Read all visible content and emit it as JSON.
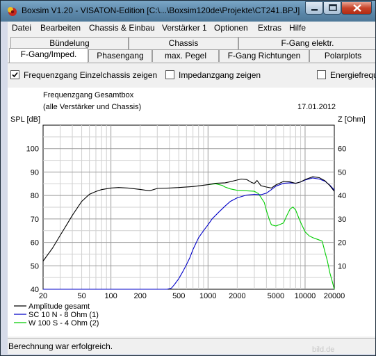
{
  "window": {
    "title": "Boxsim V1.20 - VISATON-Edition [C:\\...\\Boxsim120de\\Projekte\\CT241.BPJ]"
  },
  "menu": [
    "Datei",
    "Bearbeiten",
    "Chassis & Einbau",
    "Verstärker 1",
    "Optionen",
    "Extras",
    "Hilfe"
  ],
  "tabs_back": [
    "Bündelung",
    "Chassis",
    "F-Gang elektr."
  ],
  "tabs_front": [
    "F-Gang/Imped.",
    "Phasengang",
    "max. Pegel",
    "F-Gang Richtungen",
    "Polarplots"
  ],
  "checkboxes": [
    {
      "label": "Frequenzgang Einzelchassis zeigen",
      "checked": true
    },
    {
      "label": "Impedanzgang zeigen",
      "checked": false
    },
    {
      "label": "Energiefrequ",
      "checked": false
    }
  ],
  "status": "Berechnung war erfolgreich.",
  "watermark": "bild.de",
  "chart_data": {
    "type": "line",
    "title": "Frequenzgang Gesamtbox",
    "subtitle": "(alle Verstärker und Chassis)",
    "date": "17.01.2012",
    "ylabel": "SPL [dB]",
    "y2label": "Z [Ohm]",
    "xscale": "log",
    "xlim": [
      20,
      20000
    ],
    "ylim": [
      40,
      110
    ],
    "y2lim": [
      0,
      70
    ],
    "xticks": [
      "20",
      "50",
      "100",
      "200",
      "500",
      "1000",
      "2000",
      "5000",
      "10000",
      "20000"
    ],
    "yticks": [
      "40",
      "50",
      "60",
      "70",
      "80",
      "90",
      "100"
    ],
    "y2ticks": [
      "10",
      "20",
      "30",
      "40",
      "50",
      "60"
    ],
    "grid": true,
    "legend": "bottom-left",
    "series": [
      {
        "name": "Amplitude gesamt",
        "color": "#000000",
        "points": [
          [
            20,
            52
          ],
          [
            25,
            57.5
          ],
          [
            30,
            63
          ],
          [
            35,
            67.5
          ],
          [
            40,
            71.5
          ],
          [
            50,
            77.5
          ],
          [
            60,
            80.5
          ],
          [
            70,
            81.7
          ],
          [
            80,
            82.5
          ],
          [
            100,
            83.2
          ],
          [
            120,
            83.4
          ],
          [
            150,
            83.2
          ],
          [
            200,
            82.6
          ],
          [
            250,
            82
          ],
          [
            300,
            83
          ],
          [
            400,
            83.2
          ],
          [
            500,
            83.4
          ],
          [
            700,
            83.8
          ],
          [
            1000,
            84.6
          ],
          [
            1200,
            85.2
          ],
          [
            1500,
            85.4
          ],
          [
            1700,
            85.9
          ],
          [
            2000,
            86.6
          ],
          [
            2200,
            87
          ],
          [
            2500,
            86.8
          ],
          [
            2800,
            85.6
          ],
          [
            3000,
            85.1
          ],
          [
            3200,
            86.4
          ],
          [
            3500,
            84.2
          ],
          [
            4000,
            83.6
          ],
          [
            4500,
            83.2
          ],
          [
            5000,
            84.5
          ],
          [
            6000,
            86
          ],
          [
            7000,
            85.8
          ],
          [
            8000,
            85.2
          ],
          [
            9000,
            85.8
          ],
          [
            10000,
            86.8
          ],
          [
            12000,
            88
          ],
          [
            14000,
            87.6
          ],
          [
            16000,
            86.3
          ],
          [
            18000,
            84.2
          ],
          [
            20000,
            81.8
          ]
        ]
      },
      {
        "name": "SC 10 N - 8 Ohm (1)",
        "color": "#0000c8",
        "points": [
          [
            20,
            40
          ],
          [
            100,
            40
          ],
          [
            200,
            40
          ],
          [
            300,
            40
          ],
          [
            380,
            40
          ],
          [
            420,
            40.5
          ],
          [
            450,
            42
          ],
          [
            500,
            44.5
          ],
          [
            550,
            47.5
          ],
          [
            600,
            50.5
          ],
          [
            650,
            53.5
          ],
          [
            700,
            57
          ],
          [
            800,
            62
          ],
          [
            900,
            65
          ],
          [
            1000,
            67.5
          ],
          [
            1100,
            70
          ],
          [
            1300,
            73
          ],
          [
            1500,
            75.5
          ],
          [
            1700,
            77.5
          ],
          [
            2000,
            79
          ],
          [
            2500,
            80.2
          ],
          [
            3000,
            80.5
          ],
          [
            3500,
            80.3
          ],
          [
            4000,
            81
          ],
          [
            4500,
            82.5
          ],
          [
            5000,
            84
          ],
          [
            6000,
            85.2
          ],
          [
            7000,
            85.4
          ],
          [
            8000,
            85.2
          ],
          [
            9000,
            85.8
          ],
          [
            10000,
            86.6
          ],
          [
            12000,
            87.5
          ],
          [
            14000,
            87
          ],
          [
            16000,
            86.1
          ],
          [
            18000,
            84.4
          ],
          [
            20000,
            82.3
          ]
        ]
      },
      {
        "name": "W 100 S - 4 Ohm (2)",
        "color": "#00cc00",
        "points": [
          [
            1000,
            84.6
          ],
          [
            1200,
            85
          ],
          [
            1400,
            84.3
          ],
          [
            1500,
            83.6
          ],
          [
            1700,
            82.8
          ],
          [
            2000,
            82.2
          ],
          [
            2500,
            82
          ],
          [
            3000,
            81.8
          ],
          [
            3300,
            80.8
          ],
          [
            3500,
            79.3
          ],
          [
            3800,
            77
          ],
          [
            4000,
            73.5
          ],
          [
            4300,
            69.5
          ],
          [
            4500,
            67.5
          ],
          [
            5000,
            67
          ],
          [
            5500,
            67.6
          ],
          [
            6000,
            68.3
          ],
          [
            6500,
            71.5
          ],
          [
            7000,
            74.2
          ],
          [
            7500,
            75.1
          ],
          [
            8000,
            73.8
          ],
          [
            8500,
            71
          ],
          [
            9000,
            68.5
          ],
          [
            10000,
            64.5
          ],
          [
            11000,
            62.8
          ],
          [
            12000,
            62
          ],
          [
            14000,
            61
          ],
          [
            15000,
            60.5
          ],
          [
            16000,
            56
          ],
          [
            17000,
            52
          ],
          [
            18000,
            47
          ],
          [
            19000,
            43.5
          ],
          [
            20000,
            40
          ]
        ]
      }
    ]
  }
}
